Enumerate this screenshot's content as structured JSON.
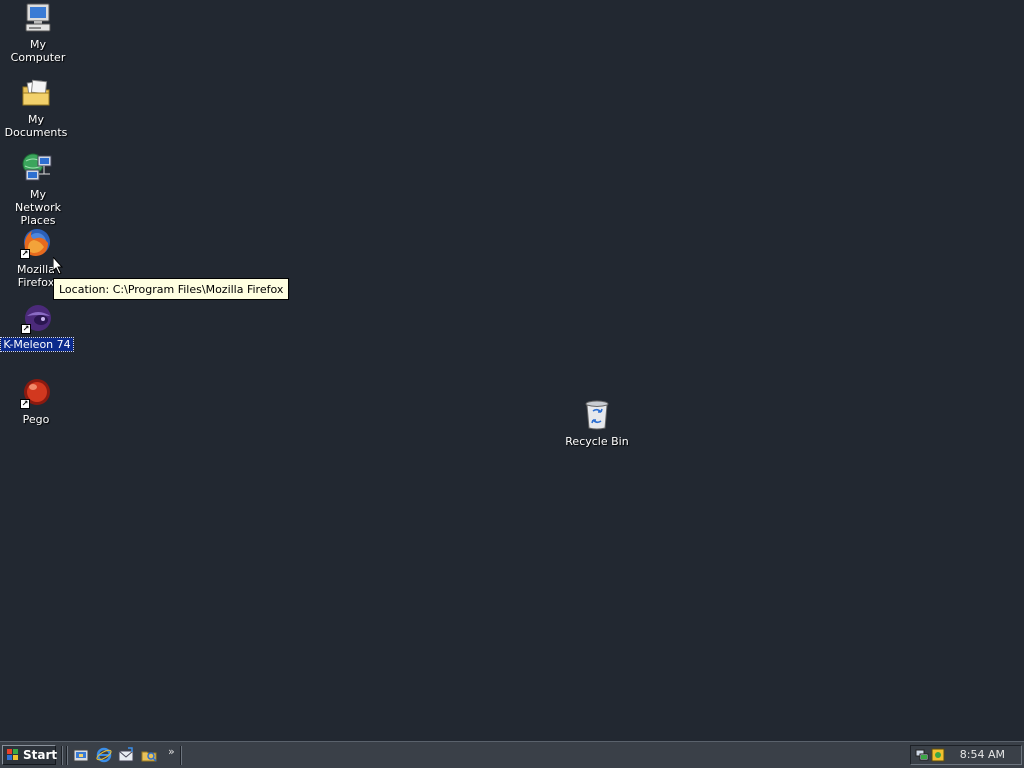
{
  "desktop": {
    "icons": [
      {
        "label": "My Computer"
      },
      {
        "label": "My Documents"
      },
      {
        "label": "My Network Places"
      },
      {
        "label": "Mozilla Firefox"
      },
      {
        "label": "K-Meleon 74"
      },
      {
        "label": "Pego"
      },
      {
        "label": "Recycle Bin"
      }
    ],
    "selected_icon": "K-Meleon 74"
  },
  "tooltip": {
    "text": "Location: C:\\Program Files\\Mozilla Firefox"
  },
  "taskbar": {
    "start_label": "Start",
    "quick_launch": [
      "show-desktop-icon",
      "internet-explorer-icon",
      "outlook-express-icon",
      "windows-explorer-icon"
    ],
    "overflow_label": "»",
    "tray_icons": [
      "network-icon",
      "security-icon"
    ],
    "clock": "8:54 AM"
  },
  "colors": {
    "desktop_background": "#222831",
    "taskbar": "#3a4048",
    "tooltip_background": "#ffffe1",
    "selection": "#0b2a8c"
  }
}
